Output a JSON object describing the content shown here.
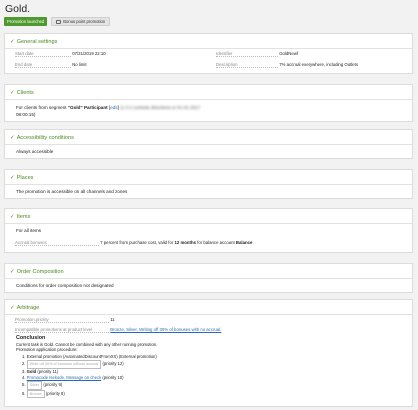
{
  "page": {
    "title": "Gold.",
    "badge_status": "Promotion launched",
    "bonus_button": "Bonus point promotion"
  },
  "general": {
    "title": "General settings",
    "start_label": "Start date",
    "start_value": "07/31/2019 22:10",
    "end_label": "End date",
    "end_value": "No limit",
    "identifier_label": "Identifier",
    "identifier_value": "GoldNewf",
    "description_label": "Description",
    "description_value": "7% accrual everywhere, including Outlets"
  },
  "clients": {
    "title": "Clients",
    "prefix": "For clients from segment",
    "segment": "\"Gold\" Participant",
    "edit_link": "edit",
    "blurred_text": "(1 0 2 contrats directions or 01 02 2017",
    "time_text": "08:00:15)"
  },
  "accessibility": {
    "title": "Accessibility conditions",
    "text": "Always accessible"
  },
  "places": {
    "title": "Places",
    "text": "The promotion is accessible on all channels and zones"
  },
  "items": {
    "title": "Items",
    "text": "For all items",
    "accrual_label": "Accrual bonuses",
    "accrual_pre": "7 percent from purchase cost, valid for",
    "accrual_months": "12 months",
    "accrual_mid": "for balance account",
    "accrual_balance": "Balance"
  },
  "order": {
    "title": "Order Composition",
    "text": "Conditions for order composition not designated"
  },
  "arbitrage": {
    "title": "Arbitrage",
    "priority_label": "Promotion priority",
    "priority_value": "11",
    "incompat_label": "Incompatible promotions at product level",
    "incompat_links": "Bronze, Silver, Writing off 30% of bonuses with no accrual.",
    "conclusion_title": "Conclusion",
    "conclusion_line1": "Current task is Gold. Cannot be combined with any other running promotion.",
    "conclusion_line2": "Promotion application procedure:",
    "procedure": [
      {
        "num": "1.",
        "text": "External promotion (AutomatedDiscountFromXX) (External promotion)",
        "style": "normal"
      },
      {
        "num": "2.",
        "text": "Write off 30% of bonuses without accrual",
        "suffix": "(priority 12)",
        "style": "boxed"
      },
      {
        "num": "3.",
        "text": "Gold",
        "suffix": "(priority 11)",
        "style": "bold"
      },
      {
        "num": "4.",
        "text": "Promocode Isekode, Message on check",
        "suffix": "(priority 10)",
        "style": "link"
      },
      {
        "num": "5.",
        "text": "Silver",
        "suffix": "(priority 9)",
        "style": "boxed"
      },
      {
        "num": "6.",
        "text": "Bronze",
        "suffix": "(priority 8)",
        "style": "boxed"
      }
    ]
  }
}
